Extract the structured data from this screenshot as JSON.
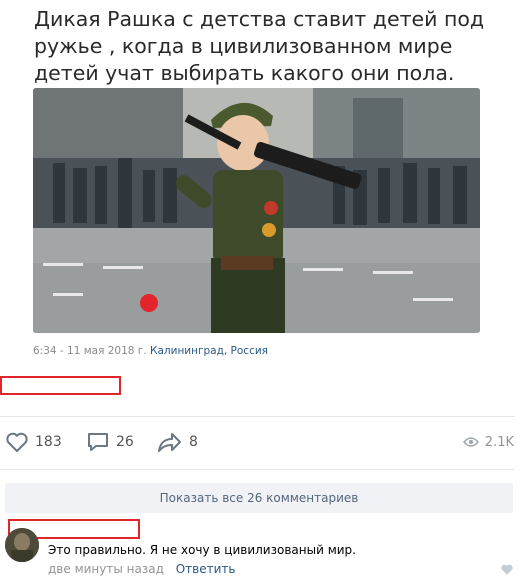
{
  "post": {
    "text": "Дикая Рашка с детства ставит детей под ружье , когда в цивилизованном мире детей учат выбирать какого они пола.",
    "meta_date": "6:34 - 11 мая 2018 г.",
    "meta_location": "Калининград, Россия"
  },
  "actions": {
    "likes": "183",
    "comments": "26",
    "shares": "8",
    "views": "2.1K"
  },
  "comments_section": {
    "show_all_label": "Показать все 26 комментариев"
  },
  "comment": {
    "text": "Это правильно. Я не хочу в цивилизованый мир.",
    "time": "две минуты назад",
    "reply_label": "Ответить"
  },
  "colors": {
    "link": "#2a5885",
    "redact_border": "#e0262b",
    "button_bg": "#f0f2f5"
  }
}
